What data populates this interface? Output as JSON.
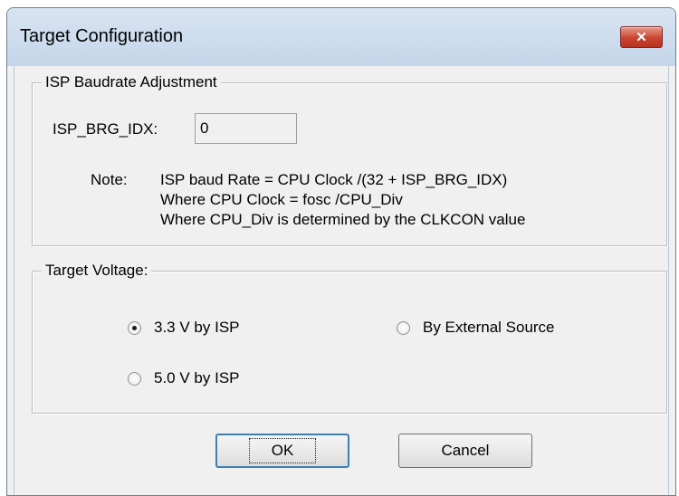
{
  "window": {
    "title": "Target Configuration",
    "close_label": "✕"
  },
  "baud_group": {
    "legend": "ISP Baudrate Adjustment",
    "field_label": "ISP_BRG_IDX:",
    "field_value": "0",
    "note_label": "Note:",
    "note_lines": [
      "ISP baud Rate = CPU Clock /(32 + ISP_BRG_IDX)",
      "Where CPU Clock = fosc /CPU_Div",
      "Where CPU_Div is determined by the CLKCON value"
    ]
  },
  "voltage_group": {
    "legend": "Target Voltage:",
    "options": [
      {
        "label": "3.3 V by ISP",
        "selected": true
      },
      {
        "label": "By External Source",
        "selected": false
      },
      {
        "label": "5.0 V by ISP",
        "selected": false
      }
    ]
  },
  "buttons": {
    "ok": "OK",
    "cancel": "Cancel"
  }
}
